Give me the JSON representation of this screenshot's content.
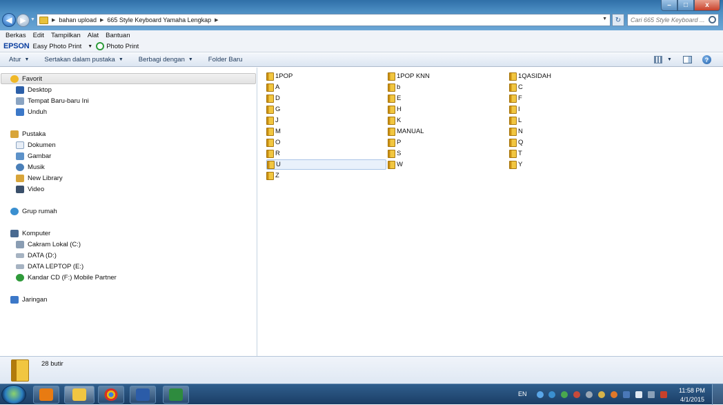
{
  "window": {
    "minimize": "–",
    "maximize": "□",
    "close": "x"
  },
  "addressbar": {
    "crumbs": [
      "bahan upload",
      "665 Style Keyboard Yamaha Lengkap"
    ]
  },
  "search": {
    "placeholder": "Cari 665 Style Keyboard ..."
  },
  "menu": [
    "Berkas",
    "Edit",
    "Tampilkan",
    "Alat",
    "Bantuan"
  ],
  "epson": {
    "logo": "EPSON",
    "easy": "Easy Photo Print",
    "photo": "Photo Print"
  },
  "toolbar": {
    "organize": "Atur",
    "include": "Sertakan dalam pustaka",
    "share": "Berbagi dengan",
    "newfolder": "Folder Baru"
  },
  "nav": {
    "favorites": "Favorit",
    "desktop": "Desktop",
    "recent": "Tempat Baru-baru Ini",
    "downloads": "Unduh",
    "libraries": "Pustaka",
    "documents": "Dokumen",
    "pictures": "Gambar",
    "music": "Musik",
    "newlib": "New Library",
    "videos": "Video",
    "homegroup": "Grup rumah",
    "computer": "Komputer",
    "localdisk": "Cakram Lokal (C:)",
    "datad": "DATA (D:)",
    "datae": "DATA LEPTOP (E:)",
    "cdf": "Kandar CD (F:)  Mobile Partner",
    "network": "Jaringan"
  },
  "files": [
    {
      "name": "1POP"
    },
    {
      "name": "A"
    },
    {
      "name": "D"
    },
    {
      "name": "G"
    },
    {
      "name": "J"
    },
    {
      "name": "M"
    },
    {
      "name": "O"
    },
    {
      "name": "R"
    },
    {
      "name": "U",
      "selected": true
    },
    {
      "name": "Z"
    },
    {
      "name": "1POP KNN"
    },
    {
      "name": "b"
    },
    {
      "name": "E"
    },
    {
      "name": "H"
    },
    {
      "name": "K"
    },
    {
      "name": "MANUAL"
    },
    {
      "name": "P"
    },
    {
      "name": "S"
    },
    {
      "name": "W"
    },
    {
      "name": "1QASIDAH"
    },
    {
      "name": "C"
    },
    {
      "name": "F"
    },
    {
      "name": "I"
    },
    {
      "name": "L"
    },
    {
      "name": "N"
    },
    {
      "name": "Q"
    },
    {
      "name": "T"
    },
    {
      "name": "Y"
    }
  ],
  "status": {
    "count": "28 butir"
  },
  "taskbar": {
    "lang": "EN",
    "time": "11:58 PM",
    "date": "4/1/2015"
  },
  "colors": {
    "folder": "#f1c641",
    "selection": "#e9f1fb",
    "titlebar": "#4d8fc4",
    "taskbar": "#1b3e66"
  },
  "icons": {
    "back": "back-arrow-icon",
    "forward": "forward-arrow-icon",
    "search": "magnifier-icon",
    "folder": "folder-icon"
  }
}
